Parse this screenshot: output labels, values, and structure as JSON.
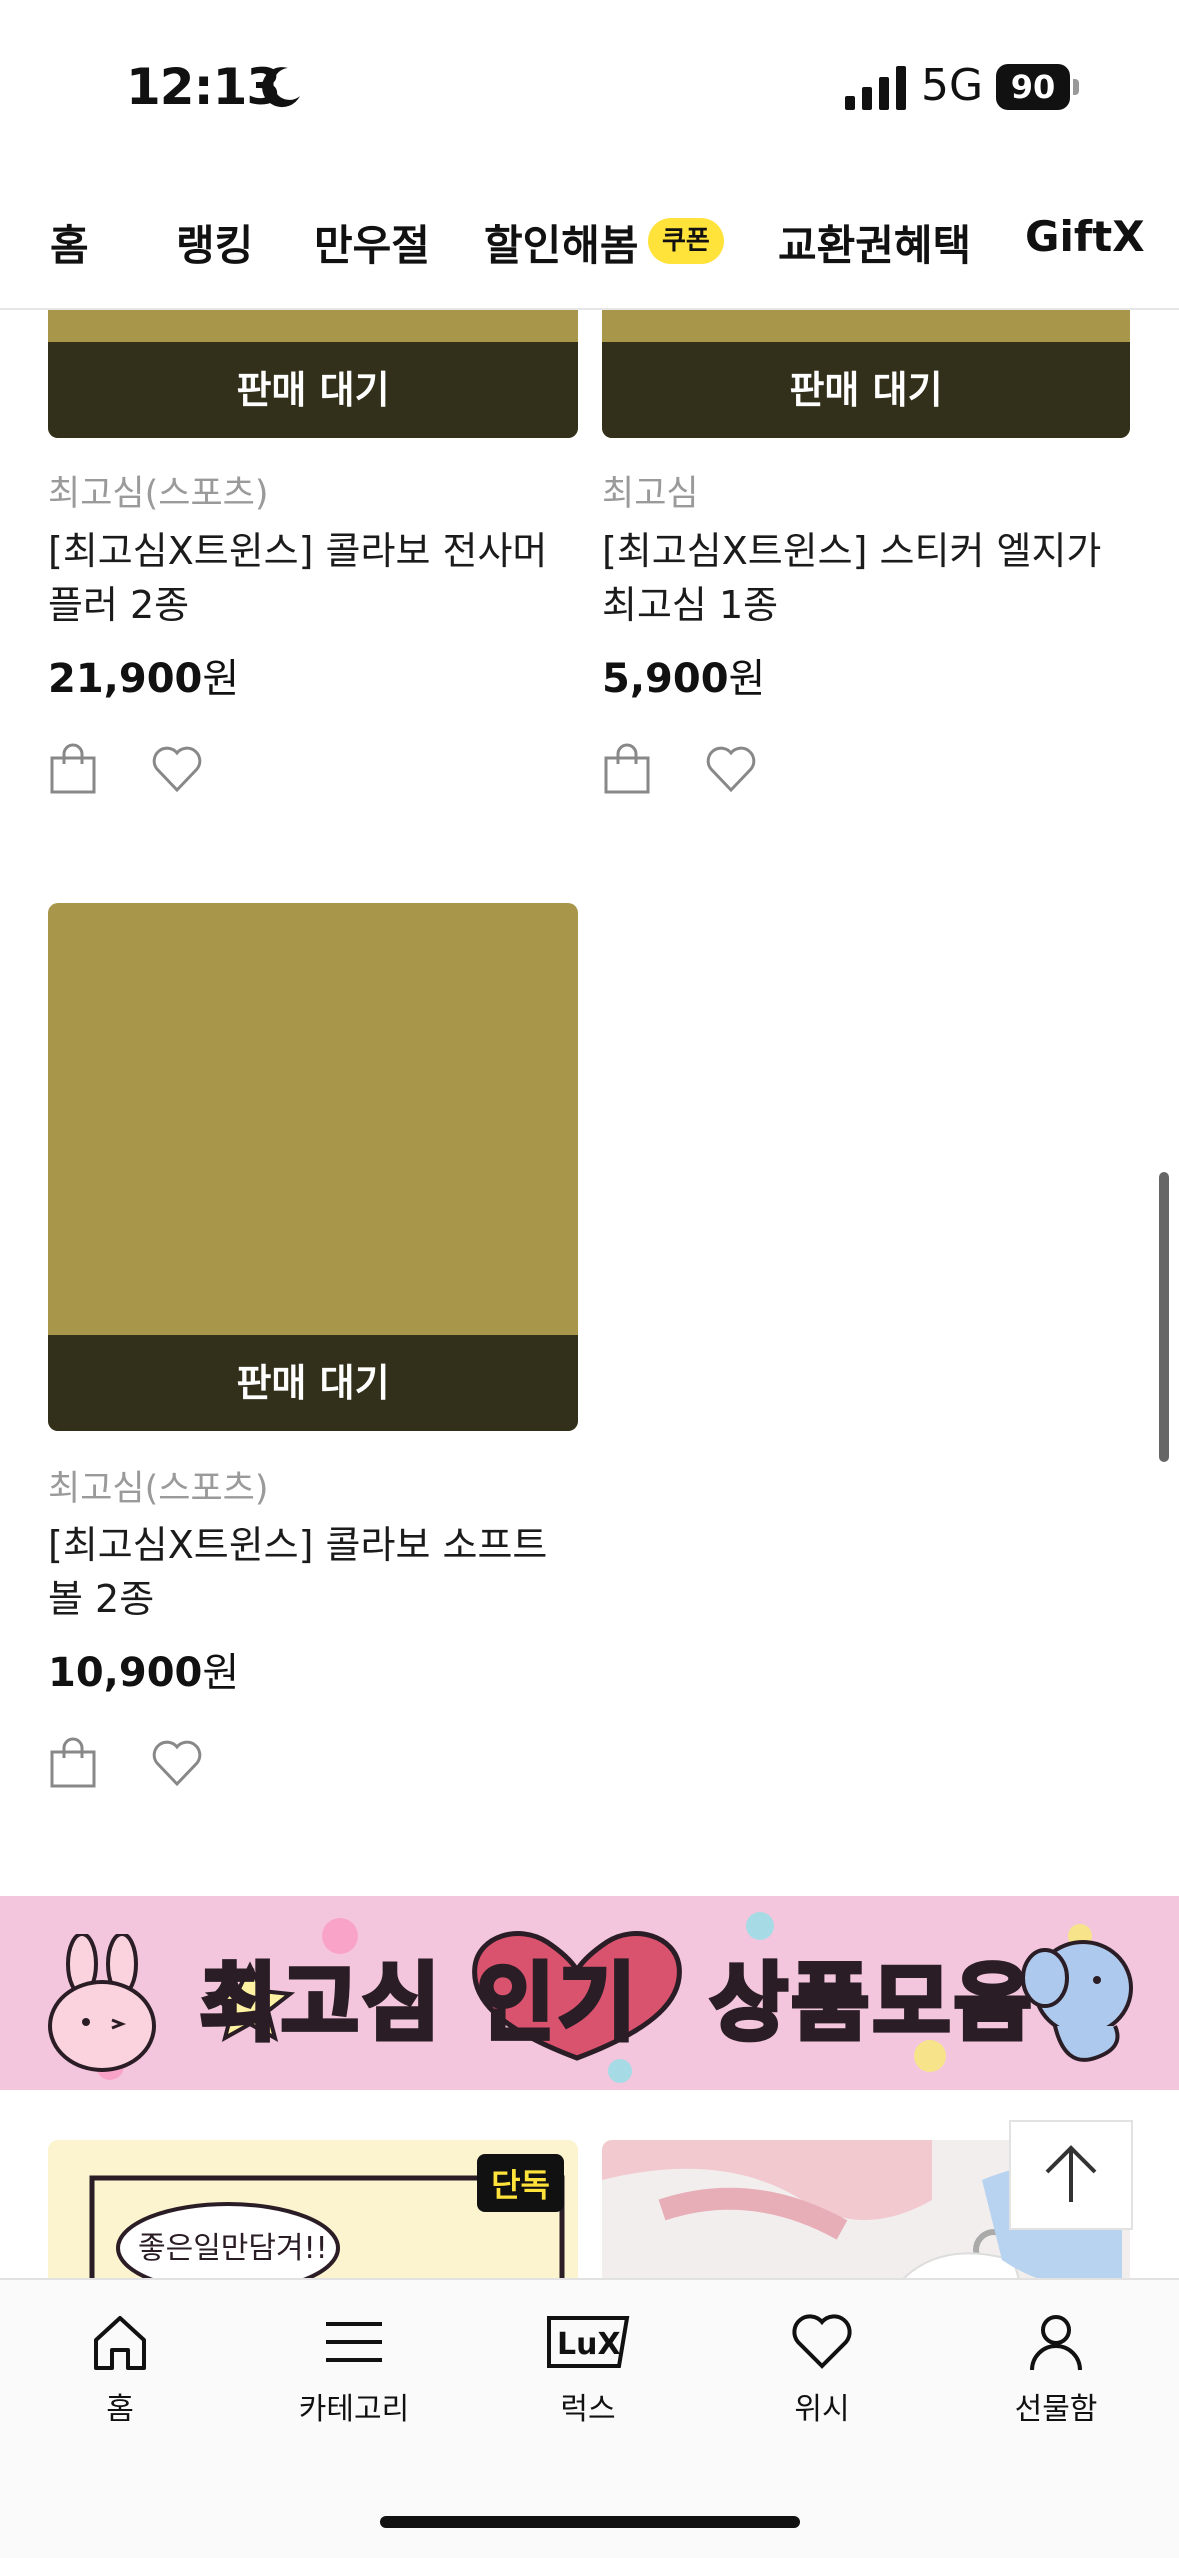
{
  "status": {
    "time": "12:13",
    "network": "5G",
    "battery": "90"
  },
  "topnav": {
    "tabs": [
      "홈",
      "랭킹",
      "만우절",
      "할인해봄",
      "교환권혜택",
      "GiftX"
    ],
    "coupon_badge": "쿠폰"
  },
  "products": [
    {
      "sold_label": "판매 대기",
      "brand": "최고심(스포츠)",
      "name_line1": "[최고심X트윈스] 콜라보 전사머",
      "name_line2": "플러 2종",
      "price": "21,900",
      "currency": "원"
    },
    {
      "sold_label": "판매 대기",
      "brand": "최고심",
      "name_line1": "[최고심X트윈스] 스티커 엘지가",
      "name_line2": "최고심 1종",
      "price": "5,900",
      "currency": "원"
    },
    {
      "sold_label": "판매 대기",
      "brand": "최고심(스포츠)",
      "name_line1": "[최고심X트윈스] 콜라보 소프트",
      "name_line2": "볼 2종",
      "price": "10,900",
      "currency": "원"
    }
  ],
  "banner": {
    "text_before": "최고심",
    "text_heart": "인기",
    "text_after": "상품모음"
  },
  "preview": {
    "exclusive_badge": "단독",
    "note": "좋은일만담겨!!"
  },
  "bottom_tabs": [
    "홈",
    "카테고리",
    "럭스",
    "위시",
    "선물함"
  ],
  "lux_logo": "LuX",
  "colors": {
    "sold_bar": "#322f1b",
    "thumb": "#a8974b",
    "coupon": "#ffe23a",
    "banner": "#f3c6de"
  }
}
